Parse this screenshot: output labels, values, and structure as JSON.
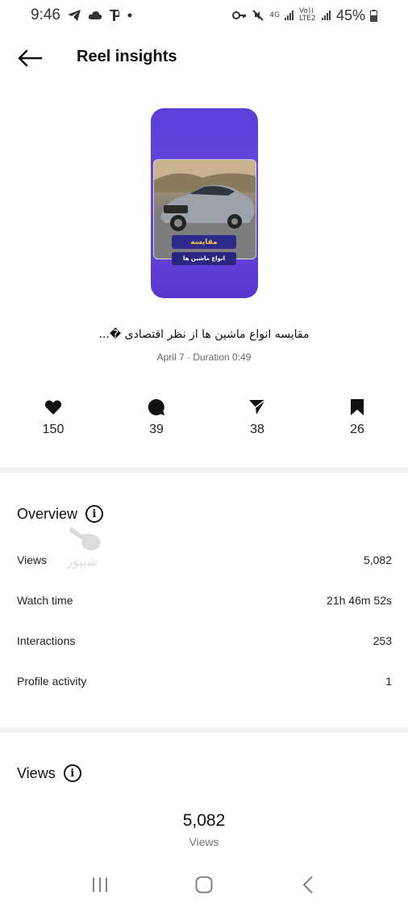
{
  "status_bar": {
    "time": "9:46",
    "network_4g": "4G",
    "volte": "Vo)) LTE2",
    "battery": "45%"
  },
  "header": {
    "title": "Reel insights"
  },
  "reel": {
    "thumbnail_title": "مقایسه",
    "thumbnail_subtitle": "انواع ماشین ها",
    "caption": "مقایسه انواع ماشین ها از نظر اقتصادی �...",
    "meta": "April 7 · Duration 0:49"
  },
  "stats": {
    "likes": "150",
    "comments": "39",
    "shares": "38",
    "saves": "26"
  },
  "overview": {
    "title": "Overview",
    "rows": [
      {
        "label": "Views",
        "value": "5,082"
      },
      {
        "label": "Watch time",
        "value": "21h 46m 52s"
      },
      {
        "label": "Interactions",
        "value": "253"
      },
      {
        "label": "Profile activity",
        "value": "1"
      }
    ]
  },
  "views_section": {
    "title": "Views",
    "total": "5,082",
    "label": "Views"
  },
  "watermark": {
    "text": "شیپور"
  },
  "colors": {
    "accent_purple": "#5b3fd8",
    "divider": "#f2f2f2"
  }
}
